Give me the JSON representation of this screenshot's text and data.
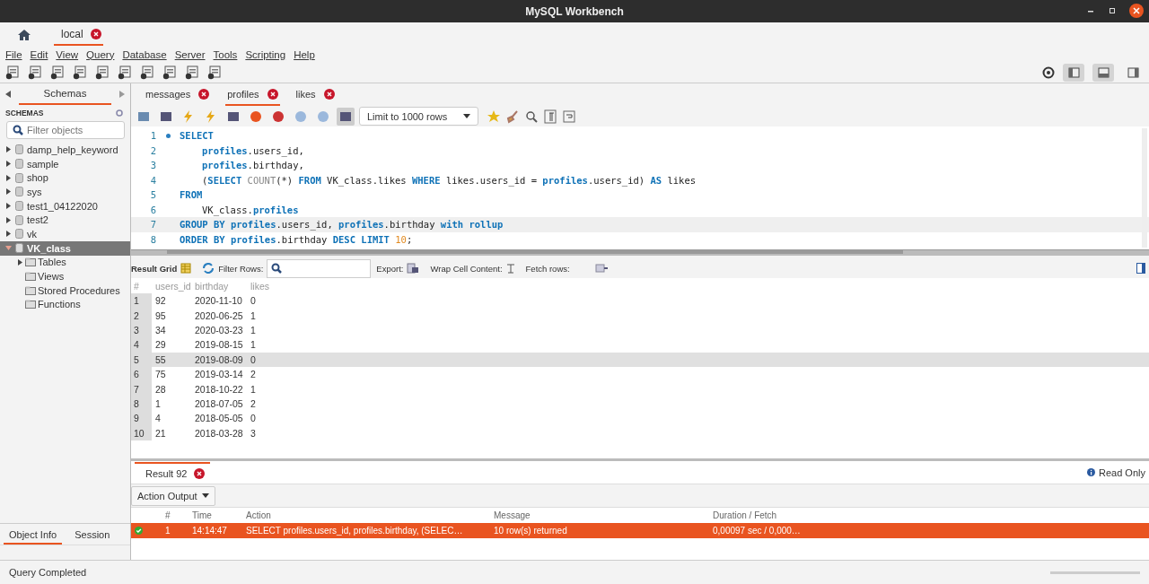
{
  "window": {
    "title": "MySQL Workbench"
  },
  "connection_tabs": [
    {
      "label": "local",
      "selected": true
    }
  ],
  "menu": [
    "File",
    "Edit",
    "View",
    "Query",
    "Database",
    "Server",
    "Tools",
    "Scripting",
    "Help"
  ],
  "sidebar": {
    "tab": "Schemas",
    "header": "SCHEMAS",
    "filter": {
      "placeholder": "Filter objects"
    },
    "items": [
      {
        "label": "damp_help_keyword",
        "expanded": false,
        "selected": false
      },
      {
        "label": "sample",
        "expanded": false,
        "selected": false
      },
      {
        "label": "shop",
        "expanded": false,
        "selected": false
      },
      {
        "label": "sys",
        "expanded": false,
        "selected": false
      },
      {
        "label": "test1_04122020",
        "expanded": false,
        "selected": false
      },
      {
        "label": "test2",
        "expanded": false,
        "selected": false
      },
      {
        "label": "vk",
        "expanded": false,
        "selected": false
      },
      {
        "label": "VK_class",
        "expanded": true,
        "selected": true,
        "children": [
          {
            "label": "Tables",
            "expandable": true
          },
          {
            "label": "Views",
            "expandable": false
          },
          {
            "label": "Stored Procedures",
            "expandable": false
          },
          {
            "label": "Functions",
            "expandable": false
          }
        ]
      }
    ],
    "bottom_tabs": [
      {
        "label": "Object Info",
        "selected": true
      },
      {
        "label": "Session",
        "selected": false
      }
    ]
  },
  "editor_tabs": [
    {
      "label": "messages",
      "selected": false
    },
    {
      "label": "profiles",
      "selected": true
    },
    {
      "label": "likes",
      "selected": false
    }
  ],
  "limit": "Limit to 1000 rows",
  "code": [
    {
      "number": "1",
      "statement_start": true,
      "indented": false,
      "highlighted": false,
      "tokens": [
        {
          "kind": "keyword",
          "text": "SELECT"
        }
      ]
    },
    {
      "number": "2",
      "statement_start": false,
      "indented": true,
      "highlighted": false,
      "tokens": [
        {
          "kind": "ident",
          "text": "profiles"
        },
        {
          "kind": "plain",
          "text": ".users_id,"
        }
      ]
    },
    {
      "number": "3",
      "statement_start": false,
      "indented": true,
      "highlighted": false,
      "tokens": [
        {
          "kind": "ident",
          "text": "profiles"
        },
        {
          "kind": "plain",
          "text": ".birthday,"
        }
      ]
    },
    {
      "number": "4",
      "statement_start": false,
      "indented": true,
      "highlighted": false,
      "tokens": [
        {
          "kind": "plain",
          "text": "("
        },
        {
          "kind": "keyword",
          "text": "SELECT "
        },
        {
          "kind": "func",
          "text": "COUNT"
        },
        {
          "kind": "plain",
          "text": "(*) "
        },
        {
          "kind": "keyword",
          "text": "FROM "
        },
        {
          "kind": "plain",
          "text": "VK_class.likes "
        },
        {
          "kind": "keyword",
          "text": "WHERE "
        },
        {
          "kind": "plain",
          "text": "likes.users_id = "
        },
        {
          "kind": "ident",
          "text": "profiles"
        },
        {
          "kind": "plain",
          "text": ".users_id) "
        },
        {
          "kind": "keyword",
          "text": "AS "
        },
        {
          "kind": "plain",
          "text": "likes"
        }
      ]
    },
    {
      "number": "5",
      "statement_start": false,
      "indented": false,
      "highlighted": false,
      "tokens": [
        {
          "kind": "keyword",
          "text": "FROM"
        }
      ]
    },
    {
      "number": "6",
      "statement_start": false,
      "indented": true,
      "highlighted": false,
      "tokens": [
        {
          "kind": "plain",
          "text": "VK_class."
        },
        {
          "kind": "ident",
          "text": "profiles"
        }
      ]
    },
    {
      "number": "7",
      "statement_start": false,
      "indented": false,
      "highlighted": true,
      "tokens": [
        {
          "kind": "keyword",
          "text": "GROUP BY "
        },
        {
          "kind": "ident",
          "text": "profiles"
        },
        {
          "kind": "plain",
          "text": ".users_id, "
        },
        {
          "kind": "ident",
          "text": "profiles"
        },
        {
          "kind": "plain",
          "text": ".birthday "
        },
        {
          "kind": "keyword",
          "text": "with rollup"
        }
      ]
    },
    {
      "number": "8",
      "statement_start": false,
      "indented": false,
      "highlighted": false,
      "tokens": [
        {
          "kind": "keyword",
          "text": "ORDER BY "
        },
        {
          "kind": "ident",
          "text": "profiles"
        },
        {
          "kind": "plain",
          "text": ".birthday "
        },
        {
          "kind": "keyword",
          "text": "DESC LIMIT "
        },
        {
          "kind": "number",
          "text": "10"
        },
        {
          "kind": "plain",
          "text": ";"
        }
      ]
    }
  ],
  "result_toolbar": {
    "grid": "Result Grid",
    "filter": "Filter Rows:",
    "export": "Export:",
    "wrap": "Wrap Cell Content:",
    "fetch": "Fetch rows:"
  },
  "grid": {
    "columns": [
      "#",
      "users_id",
      "birthday",
      "likes"
    ],
    "rows": [
      {
        "cells": [
          "1",
          "92",
          "2020-11-10",
          "0"
        ],
        "selected": false
      },
      {
        "cells": [
          "2",
          "95",
          "2020-06-25",
          "1"
        ],
        "selected": false
      },
      {
        "cells": [
          "3",
          "34",
          "2020-03-23",
          "1"
        ],
        "selected": false
      },
      {
        "cells": [
          "4",
          "29",
          "2019-08-15",
          "1"
        ],
        "selected": false
      },
      {
        "cells": [
          "5",
          "55",
          "2019-08-09",
          "0"
        ],
        "selected": true
      },
      {
        "cells": [
          "6",
          "75",
          "2019-03-14",
          "2"
        ],
        "selected": false
      },
      {
        "cells": [
          "7",
          "28",
          "2018-10-22",
          "1"
        ],
        "selected": false
      },
      {
        "cells": [
          "8",
          "1",
          "2018-07-05",
          "2"
        ],
        "selected": false
      },
      {
        "cells": [
          "9",
          "4",
          "2018-05-05",
          "0"
        ],
        "selected": false
      },
      {
        "cells": [
          "10",
          "21",
          "2018-03-28",
          "3"
        ],
        "selected": false
      }
    ]
  },
  "result_tabs": [
    {
      "label": "Result 92",
      "selected": true
    }
  ],
  "read_only": "Read Only",
  "output": {
    "dropdown": "Action Output",
    "columns": [
      "#",
      "Time",
      "Action",
      "Message",
      "Duration / Fetch"
    ],
    "rows": [
      {
        "ok": true,
        "selected": true,
        "cells": [
          "1",
          "14:14:47",
          "SELECT   profiles.users_id,    profiles.birthday,    (SELEC…",
          "10 row(s) returned",
          "0,00097 sec / 0,000…"
        ]
      }
    ]
  },
  "status_bar": "Query Completed"
}
